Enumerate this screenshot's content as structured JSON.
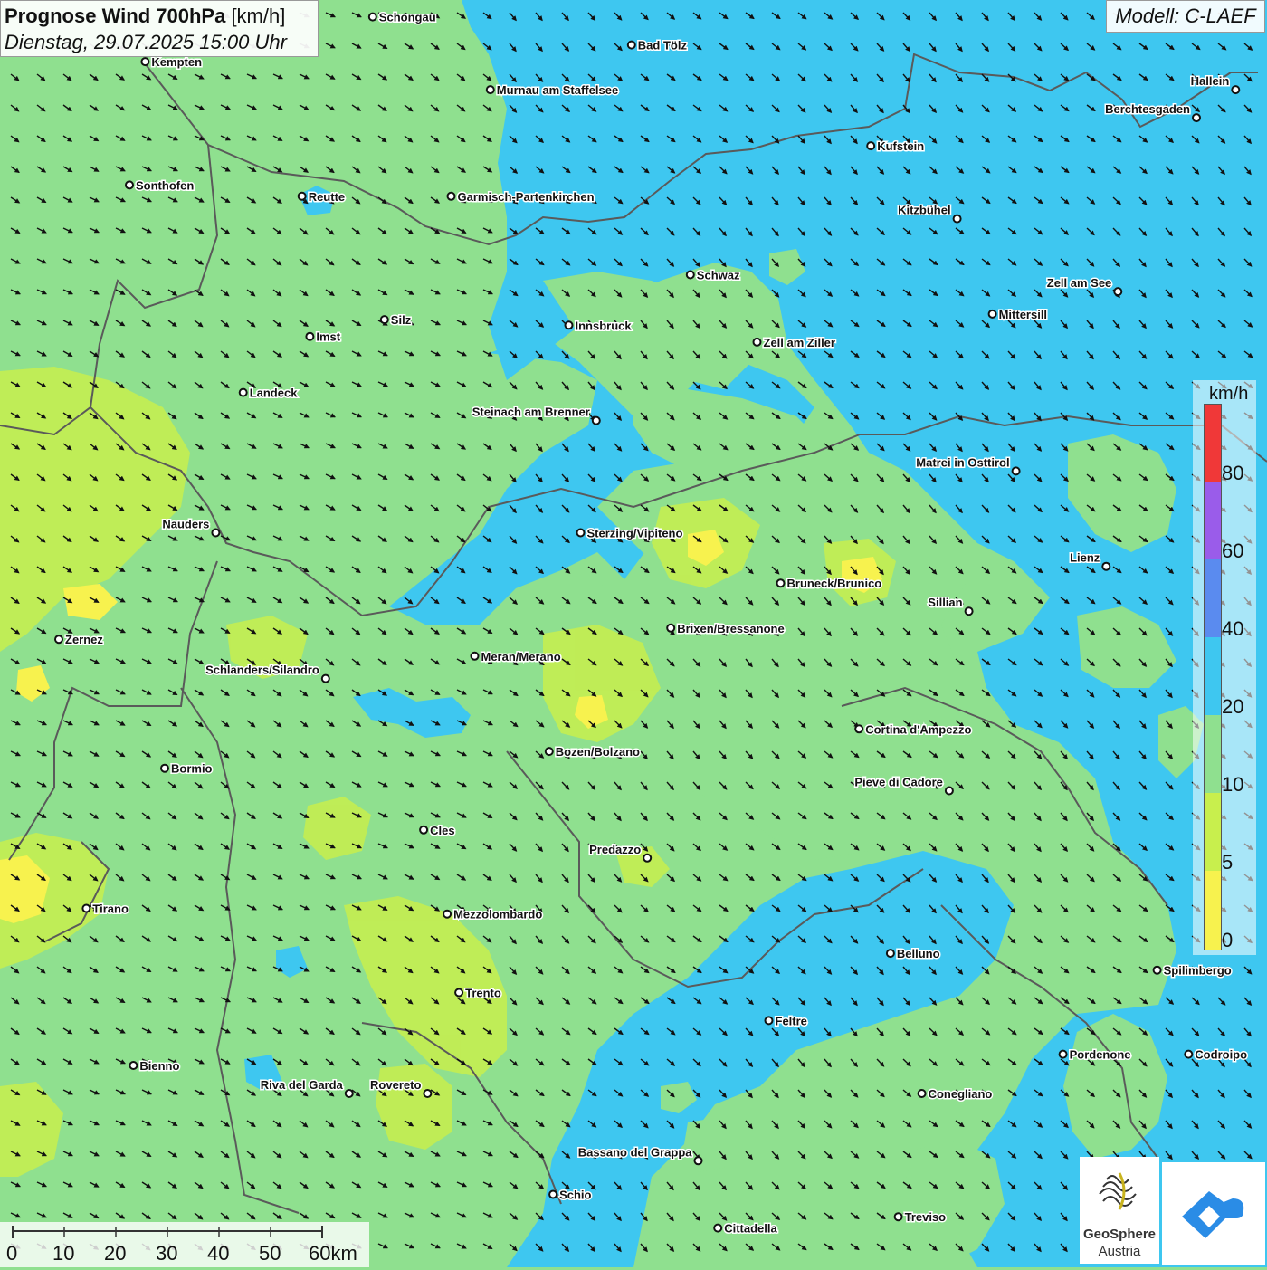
{
  "header": {
    "title_bold": "Prognose Wind 700hPa",
    "title_unit": "[km/h]",
    "datetime": "Dienstag, 29.07.2025 15:00 Uhr"
  },
  "model_label": "Modell: C-LAEF",
  "legend": {
    "unit": "km/h",
    "ticks": [
      "0",
      "5",
      "10",
      "20",
      "40",
      "60",
      "80"
    ],
    "colors": {
      "0-5": "#f7f24e",
      "5-10": "#c8ef4d",
      "10-20": "#8fe08f",
      "20-40": "#3ec7f0",
      "40-60": "#5a8bef",
      "60-80": "#9a5cea",
      "80+": "#f03838"
    }
  },
  "scale_bar": {
    "labels": [
      "0",
      "10",
      "20",
      "30",
      "40",
      "50",
      "60km"
    ]
  },
  "logo": {
    "name_line1": "GeoSphere",
    "name_line2": "Austria"
  },
  "cities": [
    {
      "name": "Schongau",
      "lon": 10.9,
      "lat": 47.81
    },
    {
      "name": "Bad Tölz",
      "lon": 11.56,
      "lat": 47.76
    },
    {
      "name": "Kempten",
      "lon": 10.32,
      "lat": 47.73
    },
    {
      "name": "Murnau am Staffelsee",
      "lon": 11.2,
      "lat": 47.68
    },
    {
      "name": "Hallein",
      "lon": 13.1,
      "lat": 47.68
    },
    {
      "name": "Berchtesgaden",
      "lon": 13.0,
      "lat": 47.63
    },
    {
      "name": "Kufstein",
      "lon": 12.17,
      "lat": 47.58
    },
    {
      "name": "Sonthofen",
      "lon": 10.28,
      "lat": 47.51
    },
    {
      "name": "Reutte",
      "lon": 10.72,
      "lat": 47.49
    },
    {
      "name": "Garmisch-Partenkirchen",
      "lon": 11.1,
      "lat": 47.49
    },
    {
      "name": "Kitzbühel",
      "lon": 12.39,
      "lat": 47.45
    },
    {
      "name": "Schwaz",
      "lon": 11.71,
      "lat": 47.35
    },
    {
      "name": "Zell am See",
      "lon": 12.8,
      "lat": 47.32
    },
    {
      "name": "Mittersill",
      "lon": 12.48,
      "lat": 47.28
    },
    {
      "name": "Innsbruck",
      "lon": 11.4,
      "lat": 47.26
    },
    {
      "name": "Silz",
      "lon": 10.93,
      "lat": 47.27
    },
    {
      "name": "Imst",
      "lon": 10.74,
      "lat": 47.24
    },
    {
      "name": "Zell am Ziller",
      "lon": 11.88,
      "lat": 47.23
    },
    {
      "name": "Landeck",
      "lon": 10.57,
      "lat": 47.14
    },
    {
      "name": "Steinach am Brenner",
      "lon": 11.47,
      "lat": 47.09
    },
    {
      "name": "Matrei in Osttirol",
      "lon": 12.54,
      "lat": 47.0
    },
    {
      "name": "Sterzing/Vipiteno",
      "lon": 11.43,
      "lat": 46.89
    },
    {
      "name": "Nauders",
      "lon": 10.5,
      "lat": 46.89
    },
    {
      "name": "Lienz",
      "lon": 12.77,
      "lat": 46.83
    },
    {
      "name": "Bruneck/Brunico",
      "lon": 11.94,
      "lat": 46.8
    },
    {
      "name": "Sillian",
      "lon": 12.42,
      "lat": 46.75
    },
    {
      "name": "Brixen/Bressanone",
      "lon": 11.66,
      "lat": 46.72
    },
    {
      "name": "Zernez",
      "lon": 10.1,
      "lat": 46.7
    },
    {
      "name": "Meran/Merano",
      "lon": 11.16,
      "lat": 46.67
    },
    {
      "name": "Schlanders/Silandro",
      "lon": 10.78,
      "lat": 46.63
    },
    {
      "name": "Cortina d'Ampezzo",
      "lon": 12.14,
      "lat": 46.54
    },
    {
      "name": "Bozen/Bolzano",
      "lon": 11.35,
      "lat": 46.5
    },
    {
      "name": "Bormio",
      "lon": 10.37,
      "lat": 46.47
    },
    {
      "name": "Pieve di Cadore",
      "lon": 12.37,
      "lat": 46.43
    },
    {
      "name": "Cles",
      "lon": 11.03,
      "lat": 46.36
    },
    {
      "name": "Predazzo",
      "lon": 11.6,
      "lat": 46.31
    },
    {
      "name": "Tirano",
      "lon": 10.17,
      "lat": 46.22
    },
    {
      "name": "Mezzolombardo",
      "lon": 11.09,
      "lat": 46.21
    },
    {
      "name": "Belluno",
      "lon": 12.22,
      "lat": 46.14
    },
    {
      "name": "Spilimbergo",
      "lon": 12.9,
      "lat": 46.11
    },
    {
      "name": "Trento",
      "lon": 11.12,
      "lat": 46.07
    },
    {
      "name": "Feltre",
      "lon": 11.91,
      "lat": 46.02
    },
    {
      "name": "Pordenone",
      "lon": 12.66,
      "lat": 45.96
    },
    {
      "name": "Codroipo",
      "lon": 12.98,
      "lat": 45.96
    },
    {
      "name": "Bienno",
      "lon": 10.29,
      "lat": 45.94
    },
    {
      "name": "Conegliano",
      "lon": 12.3,
      "lat": 45.89
    },
    {
      "name": "Riva del Garda",
      "lon": 10.84,
      "lat": 45.89
    },
    {
      "name": "Rovereto",
      "lon": 11.04,
      "lat": 45.89
    },
    {
      "name": "Bassano del Grappa",
      "lon": 11.73,
      "lat": 45.77
    },
    {
      "name": "Schio",
      "lon": 11.36,
      "lat": 45.71
    },
    {
      "name": "Treviso",
      "lon": 12.24,
      "lat": 45.67
    },
    {
      "name": "Cittadella",
      "lon": 11.78,
      "lat": 45.65
    }
  ]
}
